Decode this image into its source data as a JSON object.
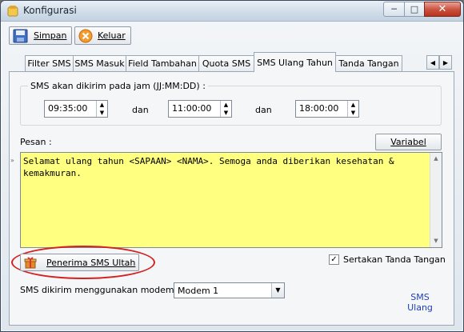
{
  "window": {
    "title": "Konfigurasi"
  },
  "toolbar": {
    "save_label": "Simpan",
    "exit_label": "Keluar"
  },
  "tabs": [
    {
      "label": "Filter SMS"
    },
    {
      "label": "SMS Masuk"
    },
    {
      "label": "Field Tambahan"
    },
    {
      "label": "Quota SMS"
    },
    {
      "label": "SMS Ulang Tahun",
      "active": true
    },
    {
      "label": "Tanda Tangan"
    }
  ],
  "schedule": {
    "label": "SMS akan dikirim pada jam (JJ:MM:DD) :",
    "times": [
      "09:35:00",
      "11:00:00",
      "18:00:00"
    ],
    "separator": "dan"
  },
  "message": {
    "label": "Pesan :",
    "variable_button": "Variabel",
    "text": "Selamat ulang tahun <SAPAAN> <NAMA>. Semoga anda diberikan kesehatan &\nkemakmuran."
  },
  "recipients_button": "Penerima SMS Ultah",
  "include_signature": {
    "label": "Sertakan Tanda Tangan",
    "checked": true
  },
  "modem": {
    "label": "SMS dikirim menggunakan modem :",
    "value": "Modem 1"
  },
  "status_link": "SMS Ulang",
  "colors": {
    "editor_bg": "#ffff80",
    "highlight": "#d52020",
    "link": "#1f3fb8"
  }
}
